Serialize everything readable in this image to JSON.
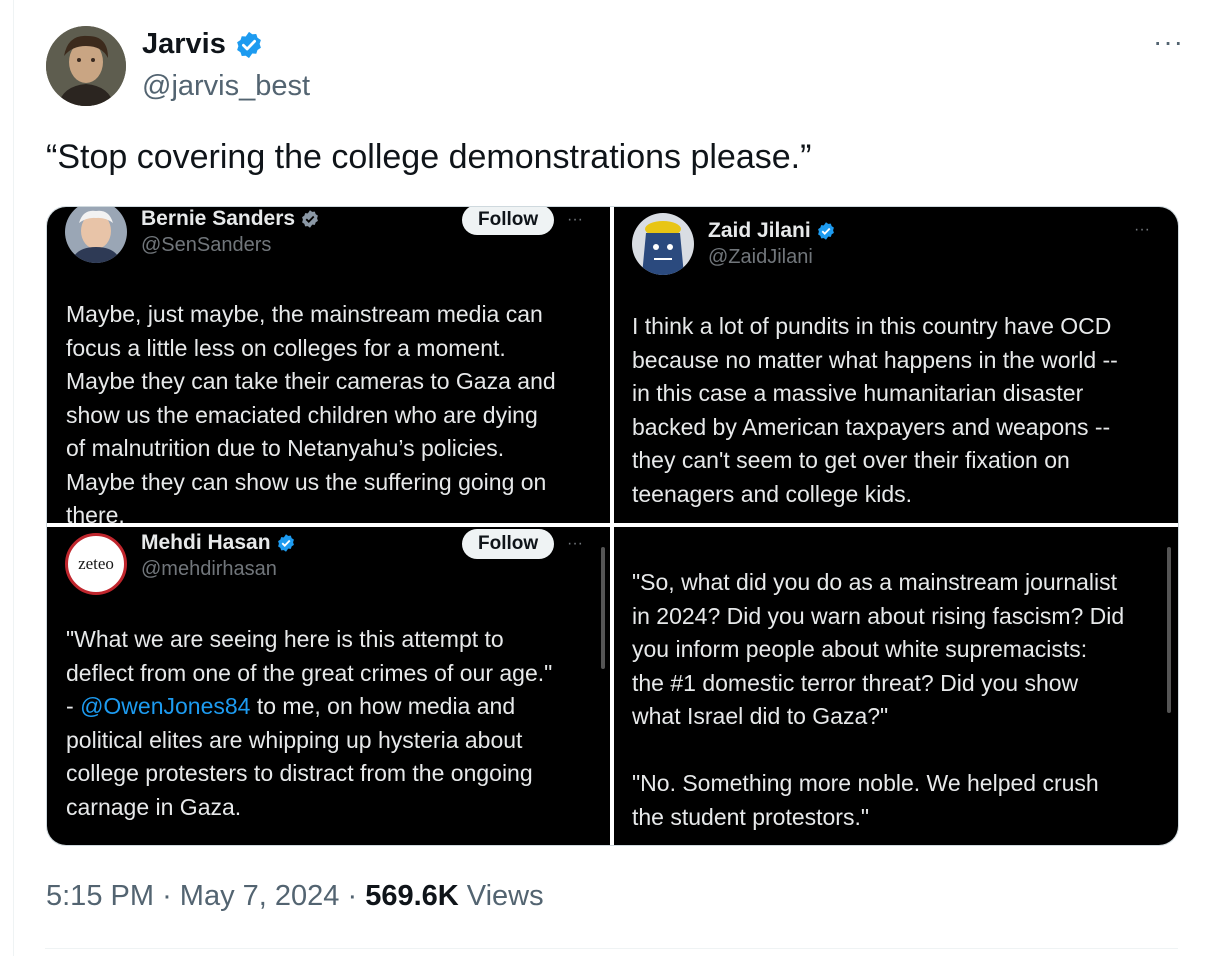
{
  "tweet": {
    "author_name": "Jarvis",
    "author_handle": "@jarvis_best",
    "text": "“Stop covering the college demonstrations please.”",
    "time": "5:15 PM",
    "separator": "·",
    "date": "May 7, 2024",
    "views_count": "569.6K",
    "views_label": "Views",
    "more": "···"
  },
  "embedded": [
    {
      "name": "Bernie Sanders",
      "handle": "@SenSanders",
      "follow": "Follow",
      "more": "···",
      "text": "Maybe, just maybe, the mainstream media can\nfocus a little less on colleges for a moment.\nMaybe they can take their cameras to Gaza and\nshow us the emaciated children who are dying\nof malnutrition due to Netanyahu’s policies.\nMaybe they can show us the suffering going on\nthere."
    },
    {
      "name": "Zaid Jilani",
      "handle": "@ZaidJilani",
      "more": "···",
      "text": "I think a lot of pundits in this country have OCD\nbecause no matter what happens in the world --\nin this case a massive humanitarian disaster\nbacked by American taxpayers and weapons --\nthey can't seem to get over their fixation on\nteenagers and college kids."
    },
    {
      "name": "Mehdi Hasan",
      "handle": "@mehdirhasan",
      "avatar_text": "zeteo",
      "follow": "Follow",
      "more": "···",
      "text_a": "\"What we are seeing here is this attempt to\ndeflect from one of the great crimes of our age.\"\n- ",
      "link": "@OwenJones84",
      "text_b": " to me, on how media and\npolitical elites are whipping up hysteria about\ncollege protesters to distract from the ongoing\ncarnage in Gaza."
    },
    {
      "text": "\"So, what did you do as a mainstream journalist\nin 2024? Did you warn about rising fascism? Did\nyou inform people about white supremacists:\nthe #1 domestic terror threat? Did you show\nwhat Israel did to Gaza?\"\n\n\"No. Something more noble. We helped crush\nthe student protestors.\""
    }
  ],
  "colors": {
    "verified": "#1d9bf0",
    "link": "#1d9bf0",
    "muted": "#536471",
    "dark_bg": "#000000"
  }
}
